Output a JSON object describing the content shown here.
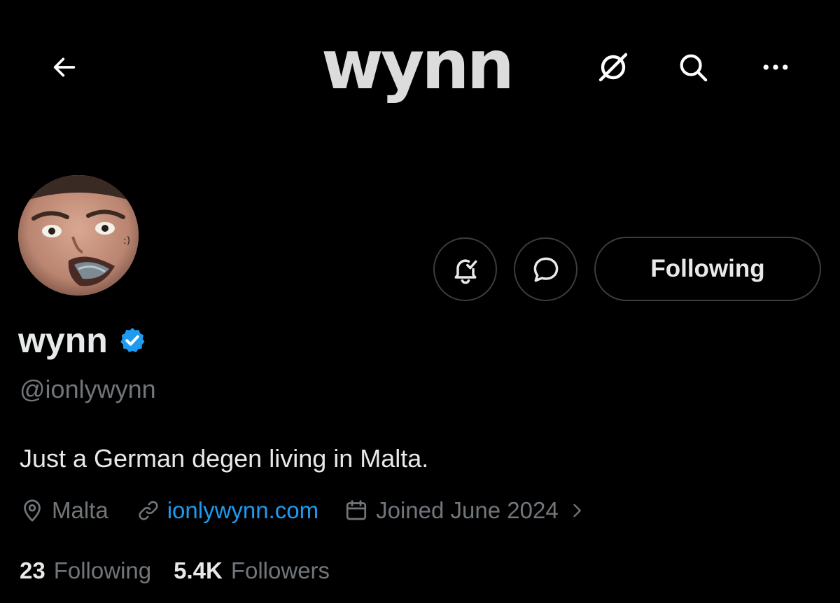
{
  "header": {
    "banner_logo_text": "wynn",
    "icons": [
      "arrow-left-icon",
      "grok-icon",
      "search-icon",
      "more-horizontal-icon"
    ]
  },
  "profile_actions": {
    "notifications_icon": "bell-check-icon",
    "message_icon": "chat-bubble-icon",
    "following_label": "Following"
  },
  "profile": {
    "display_name": "wynn",
    "verified_icon": "verified-badge-icon",
    "handle": "@ionlywynn",
    "bio": "Just a German degen living in Malta.",
    "location": "Malta",
    "website": "ionlywynn.com",
    "joined": "Joined June 2024"
  },
  "stats": {
    "following_count": "23",
    "following_label": "Following",
    "followers_count": "5.4K",
    "followers_label": "Followers"
  },
  "colors": {
    "background": "#000000",
    "primary_text": "#e7e9ea",
    "secondary_text": "#71767b",
    "link": "#1d9bf0",
    "verified": "#1d9bf0",
    "button_border": "#3a3d41"
  }
}
